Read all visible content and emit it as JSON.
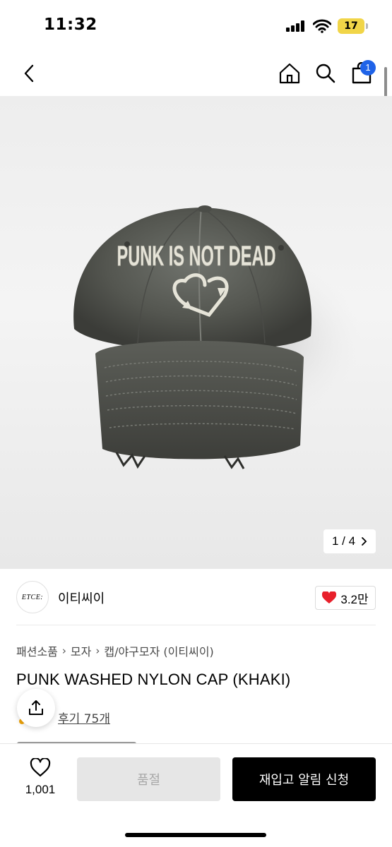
{
  "status_bar": {
    "time": "11:32",
    "battery": "17",
    "battery_color": "#f1d548"
  },
  "nav": {
    "back_icon": "chevron-left-icon",
    "home_icon": "home-icon",
    "search_icon": "search-icon",
    "cart_icon": "shopping-bag-icon",
    "cart_badge": "1",
    "badge_color": "#1f63e8"
  },
  "image": {
    "cap_text": "PUNK IS NOT DEAD",
    "counter": "1 / 4"
  },
  "brand": {
    "logo_text": "ETCE:",
    "name": "이티씨이",
    "likes": "3.2만"
  },
  "breadcrumb": {
    "items": [
      "패션소품",
      "모자",
      "캡/야구모자 (이티씨이)"
    ]
  },
  "product": {
    "title": "PUNK WASHED NYLON CAP (KHAKI)",
    "review_label": "후기 75개"
  },
  "bottom_bar": {
    "wish_count": "1,001",
    "soldout_label": "품절",
    "restock_label": "재입고 알림 신청"
  },
  "colors": {
    "like_heart": "#e8202b",
    "primary_button": "#000000",
    "disabled_button": "#e6e6e6"
  }
}
